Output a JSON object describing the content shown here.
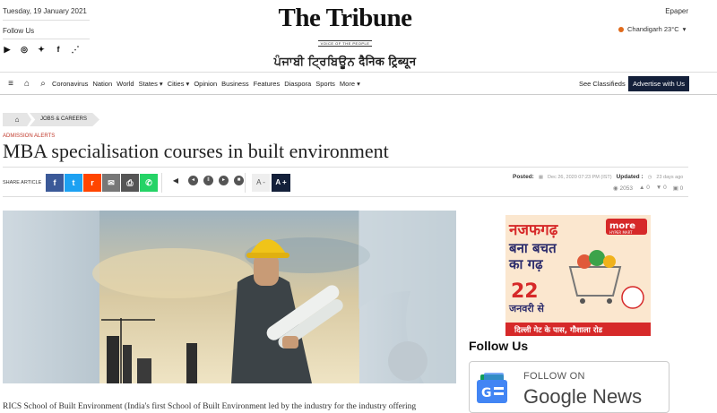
{
  "header": {
    "date": "Tuesday, 19 January 2021",
    "follow_us": "Follow Us",
    "social_icons": [
      "youtube-icon",
      "instagram-icon",
      "twitter-icon",
      "facebook-icon",
      "rss-icon"
    ],
    "logo_title": "The Tribune",
    "logo_tagline": "VOICE OF THE PEOPLE",
    "logo_sister": "ਪੰਜਾਬੀ ਟ੍ਰਿਬਿਊਨ  दैनिक ट्रिब्यून",
    "epaper": "Epaper",
    "weather": "Chandigarh 23°C"
  },
  "nav": {
    "items": [
      "Coronavirus",
      "Nation",
      "World",
      "States ▾",
      "Cities ▾",
      "Opinion",
      "Business",
      "Features",
      "Diaspora",
      "Sports",
      "More ▾"
    ],
    "classifieds": "See Classifieds",
    "advertise": "Advertise with Us"
  },
  "article": {
    "breadcrumb": "JOBS & CAREERS",
    "tag": "ADMISSION ALERTS",
    "title": "MBA specialisation courses in built environment",
    "share_label": "SHARE ARTICLE",
    "font_minus": "A -",
    "font_plus": "A +",
    "posted_label": "Posted:",
    "posted_date": "Dec 26, 2020 07:23 PM (IST)",
    "updated_label": "Updated :",
    "updated_value": "23 days ago",
    "views": "2053",
    "likes": "0",
    "dislikes": "0",
    "comments": "0",
    "body_start": "RICS School of Built Environment (India's first School of Built Environment led by the industry for the industry offering"
  },
  "sidebar": {
    "ad_line1": "नजफगढ़",
    "ad_line2": "बना बचत",
    "ad_line3": "का गढ़",
    "ad_num": "22",
    "ad_month": "जनवरी से",
    "ad_brand": "more",
    "ad_brand_sub": "HYPER MART",
    "ad_footer": "दिल्ली गेट के पास, गौशाला रोड",
    "follow_us": "Follow Us",
    "gnews_follow": "FOLLOW ON",
    "gnews_name": "Google News"
  }
}
